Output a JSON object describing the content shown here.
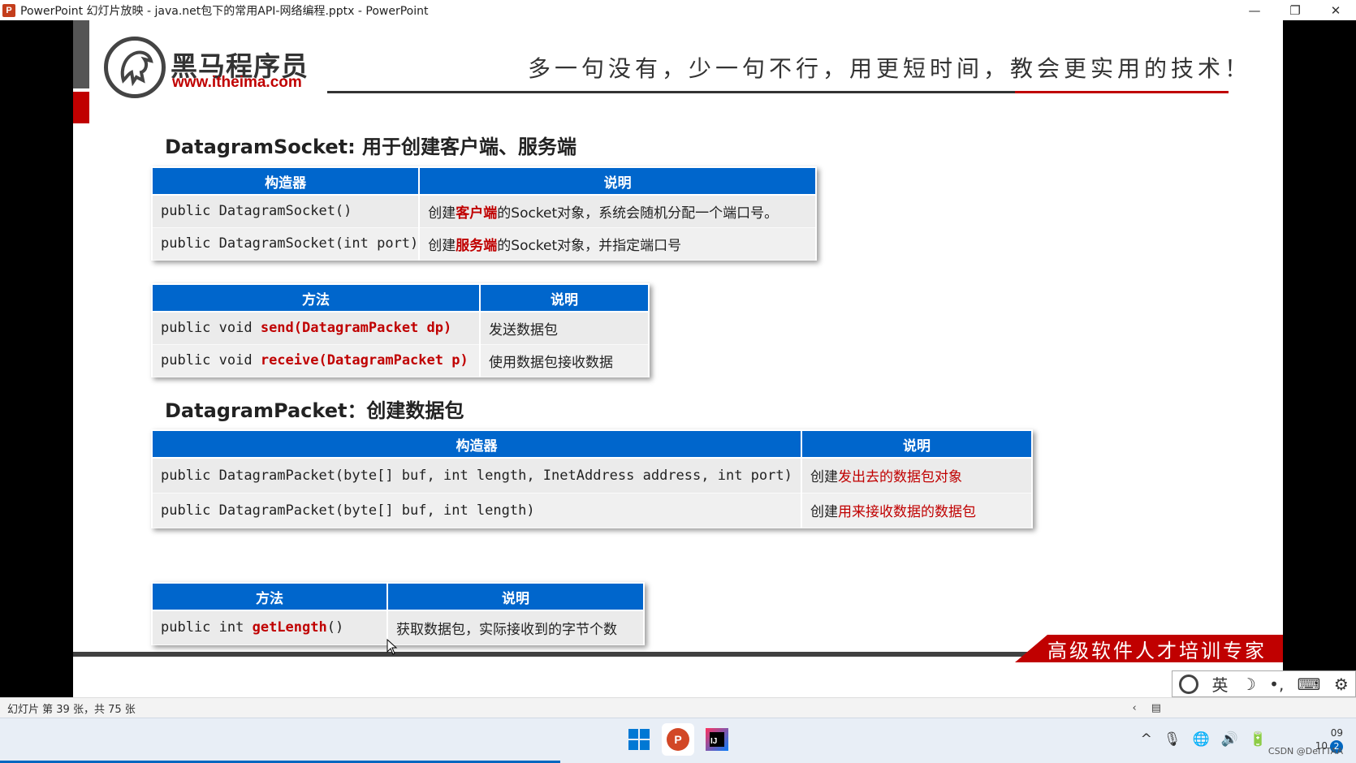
{
  "window": {
    "title": "PowerPoint 幻灯片放映  -  java.net包下的常用API-网络编程.pptx - PowerPoint",
    "app_icon": "P",
    "minimize_icon": "—",
    "restore_icon": "❐",
    "close_icon": "✕"
  },
  "slide": {
    "logo_name": "黑马程序员",
    "logo_url": "www.itheima.com",
    "slogan": "多一句没有，少一句不行，用更短时间，教会更实用的技术！",
    "footer_tag": "高级软件人才培训专家",
    "section1_title": "DatagramSocket: 用于创建客户端、服务端",
    "section2_title": "DatagramPacket：创建数据包",
    "table1": {
      "headers": [
        "构造器",
        "说明"
      ],
      "rows": [
        {
          "code": "public DatagramSocket()",
          "desc_pre": "创建",
          "desc_hl": "客户端",
          "desc_post": "的Socket对象，系统会随机分配一个端口号。"
        },
        {
          "code": "public DatagramSocket(int port)",
          "desc_pre": "创建",
          "desc_hl": "服务端",
          "desc_post": "的Socket对象，并指定端口号"
        }
      ]
    },
    "table2": {
      "headers": [
        "方法",
        "说明"
      ],
      "rows": [
        {
          "code_pre": "public void ",
          "code_hl": "send(DatagramPacket dp)",
          "desc": "发送数据包"
        },
        {
          "code_pre": "public void ",
          "code_hl": "receive(DatagramPacket p)",
          "desc": "使用数据包接收数据"
        }
      ]
    },
    "table3": {
      "headers": [
        "构造器",
        "说明"
      ],
      "rows": [
        {
          "code": "public DatagramPacket(byte[] buf, int length, InetAddress address, int port)",
          "desc_pre": "创建",
          "desc_hl": "发出去的数据包对象"
        },
        {
          "code": "public DatagramPacket(byte[] buf, int length)",
          "desc_pre": "创建",
          "desc_hl": "用来接收数据的数据包"
        }
      ]
    },
    "table4": {
      "headers": [
        "方法",
        "说明"
      ],
      "rows": [
        {
          "code_pre": "public int ",
          "code_hl": "getLength",
          "code_post": "()",
          "desc": "获取数据包，实际接收到的字节个数"
        }
      ]
    }
  },
  "ime_toolbar": {
    "mode": "英",
    "moon": "☽",
    "punct": "•,",
    "keyboard": "⌨",
    "settings": "⚙"
  },
  "status_bar": {
    "slide_info": "幻灯片 第 39 张，共 75 张",
    "prev_icon": "‹",
    "notes_icon": "▤"
  },
  "taskbar": {
    "tray_up": "^",
    "mic": "🎙",
    "globe": "🌐",
    "volume": "🔊",
    "battery": "🔋",
    "time": "09",
    "date": "10",
    "notif_count": "2",
    "watermark": "CSDN @DeITTAA"
  }
}
